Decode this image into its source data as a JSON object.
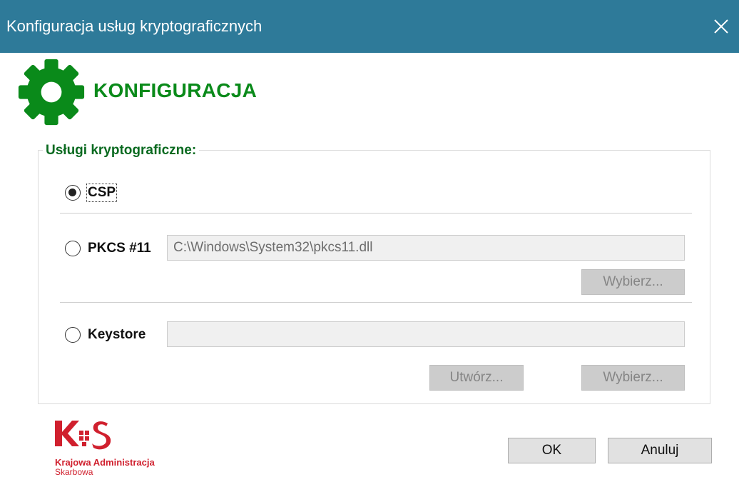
{
  "window": {
    "title": "Konfiguracja usług kryptograficznych",
    "close_icon": "close-icon"
  },
  "header": {
    "icon": "gear-icon",
    "icon_color": "#0a8a1a",
    "title": "KONFIGURACJA"
  },
  "group": {
    "legend": "Usługi kryptograficzne:",
    "options": {
      "csp": {
        "label": "CSP",
        "checked": true
      },
      "pkcs": {
        "label": "PKCS #11",
        "checked": false,
        "path_value": "C:\\Windows\\System32\\pkcs11.dll",
        "browse_label": "Wybierz..."
      },
      "keystore": {
        "label": "Keystore",
        "checked": false,
        "path_value": "",
        "create_label": "Utwórz...",
        "browse_label": "Wybierz..."
      }
    }
  },
  "footer": {
    "logo": {
      "mark": "KAS",
      "line1": "Krajowa Administracja",
      "line2": "Skarbowa",
      "color": "#d0202e"
    },
    "ok_label": "OK",
    "cancel_label": "Anuluj"
  },
  "colors": {
    "titlebar": "#2e7a99",
    "accent_green": "#0a8a1a"
  }
}
